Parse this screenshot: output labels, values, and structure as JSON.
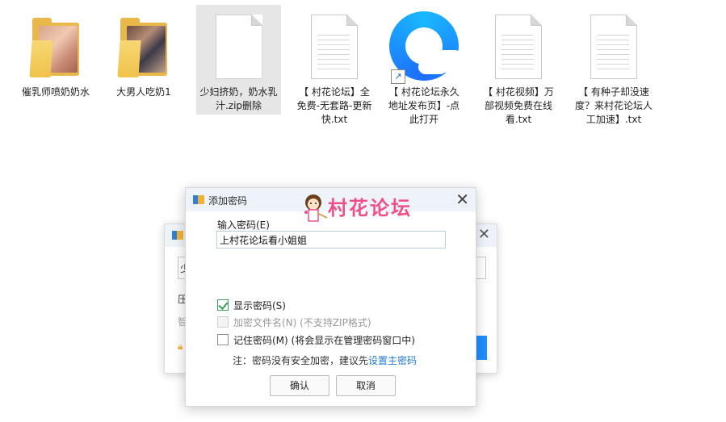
{
  "desktop": {
    "items": [
      {
        "label": "催乳师喷奶奶水",
        "type": "folder"
      },
      {
        "label": "大男人吃奶1",
        "type": "folder"
      },
      {
        "label": "少妇挤奶，奶水乳汁.zip删除",
        "type": "file"
      },
      {
        "label": "【 村花论坛】全免费-无套路-更新快.txt",
        "type": "txt"
      },
      {
        "label": "【 村花论坛永久地址发布页】-点此打开",
        "type": "shortcut"
      },
      {
        "label": "【 村花视频】万部视频免费在线看.txt",
        "type": "txt"
      },
      {
        "label": "【 有种子却没速度？来村花论坛人工加速】.txt",
        "type": "txt"
      }
    ]
  },
  "bg_dialog": {
    "line1": "压",
    "line2": "智",
    "input_fragment": "少"
  },
  "dialog": {
    "title": "添加密码",
    "brand": "村花论坛",
    "close": "✕",
    "password_label": "输入密码(E)",
    "password_value": "上村花论坛看小姐姐",
    "show_password": "显示密码(S)",
    "encrypt_names": "加密文件名(N) (不支持ZIP格式)",
    "remember_password": "记住密码(M) (将会显示在管理密码窗口中)",
    "note_prefix": "注：密码没有安全加密，建议先",
    "note_link": "设置主密码",
    "ok": "确认",
    "cancel": "取消",
    "show_password_checked": true,
    "encrypt_names_disabled": true,
    "remember_password_checked": false
  },
  "colors": {
    "brand": "#f0508a",
    "link": "#1e79d9",
    "check": "#3a9e5a"
  }
}
